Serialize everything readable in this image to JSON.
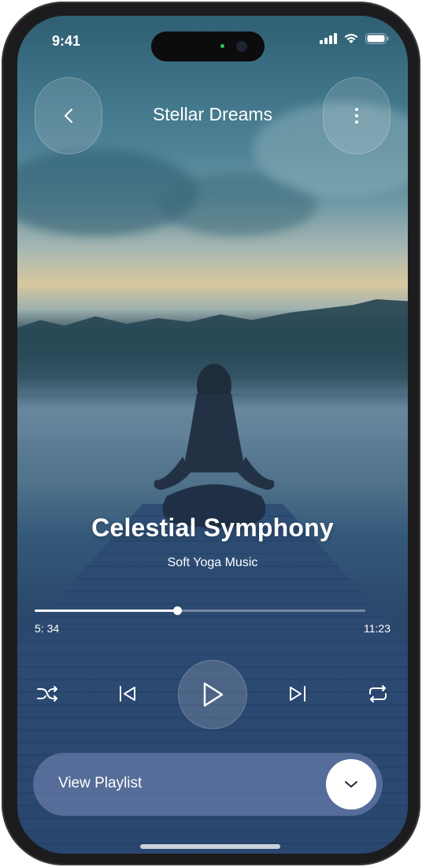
{
  "status_bar": {
    "time": "9:41",
    "icons": [
      "cellular-signal-icon",
      "wifi-icon",
      "battery-icon"
    ]
  },
  "header": {
    "title": "Stellar Dreams",
    "back_icon": "chevron-left-icon",
    "menu_icon": "more-vertical-icon"
  },
  "now_playing": {
    "title": "Celestial Symphony",
    "subtitle": "Soft Yoga Music",
    "elapsed": "5: 34",
    "duration": "11:23",
    "progress": 0.43
  },
  "controls": {
    "shuffle_icon": "shuffle-icon",
    "previous_icon": "skip-previous-icon",
    "play_icon": "play-icon",
    "next_icon": "skip-next-icon",
    "repeat_icon": "repeat-icon"
  },
  "playlist": {
    "label": "View Playlist",
    "toggle_icon": "chevron-down-icon"
  },
  "colors": {
    "accent": "#ffffff",
    "background_top": "#3d7286",
    "background_bottom": "#1b3460"
  }
}
